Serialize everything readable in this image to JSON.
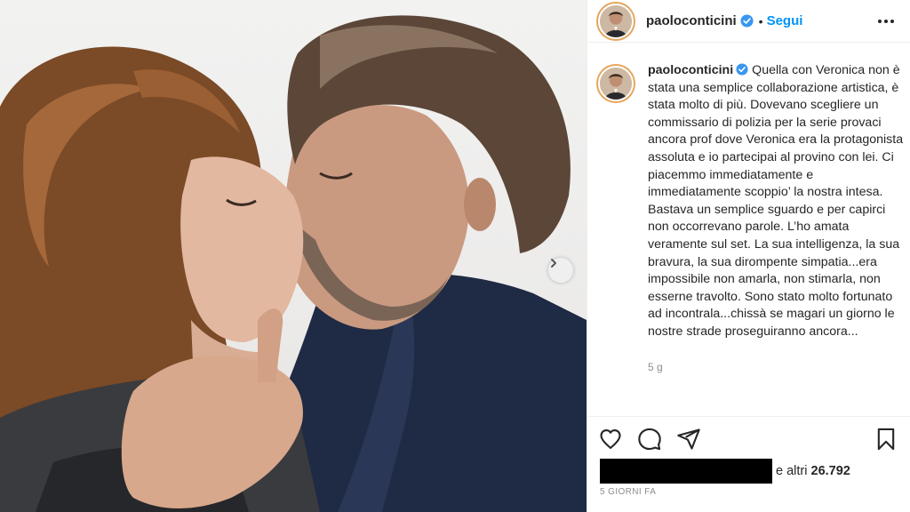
{
  "post": {
    "username": "paoloconticini",
    "follow_dot": "•",
    "follow_label": "Segui",
    "caption": "Quella con Veronica non è stata una semplice collaborazione artistica, è stata molto di più. Dovevano scegliere un commissario di polizia per la serie provaci ancora prof dove Veronica era la protagonista assoluta e io partecipai al provino con lei. Ci piacemmo immediatamente e immediatamente scoppio’ la nostra intesa. Bastava un semplice sguardo e per capirci non occorrevano parole. L’ho amata veramente sul set. La sua intelligenza, la sua bravura, la sua dirompente simpatia...era impossibile non amarla, non stimarla, non esserne travolto. Sono stato molto fortunato ad incontrala...chissà se magari un giorno le nostre strade proseguiranno ancora...",
    "caption_age": "5 g",
    "likes_prefix": "e altri",
    "likes_count": "26.792",
    "posted_ago": "5 GIORNI FA"
  },
  "icons": {
    "verified": "verified-badge-icon",
    "more": "more-options-icon",
    "like": "heart-icon",
    "comment": "comment-icon",
    "share": "paper-plane-icon",
    "save": "bookmark-icon",
    "next": "chevron-right-icon"
  },
  "colors": {
    "accent": "#0095f6",
    "verified": "#3897f0",
    "text": "#262626",
    "muted": "#8e8e8e"
  }
}
